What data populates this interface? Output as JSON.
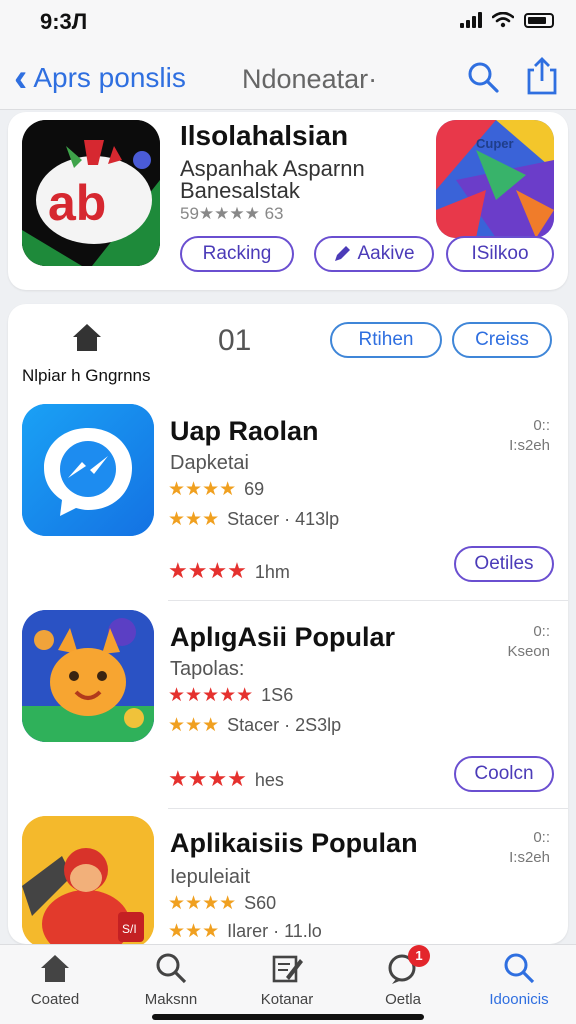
{
  "status": {
    "time": "9:3Л"
  },
  "nav": {
    "back_label": "Aprs ponslis",
    "title": "Ndoneatar·"
  },
  "featured": {
    "title": "Ilsolahalsian",
    "subtitle1": "Aspanhak Asparnn",
    "subtitle2": "Banesalstak",
    "rating": "59★★★★ 63",
    "side_icon_text": "Cuper",
    "buttons": [
      {
        "label": "Racking"
      },
      {
        "label": "Aakive"
      },
      {
        "label": "ISilkoo"
      }
    ]
  },
  "list": {
    "caption": "Nlpiar h Gngrnns",
    "count": "01",
    "header_buttons": [
      {
        "label": "Rtihen"
      },
      {
        "label": "Creiss"
      }
    ],
    "apps": [
      {
        "title": "Uap Raolan",
        "subtitle": "Dapketai",
        "stars1": "★★★★",
        "stars1_meta": "69",
        "stars2": "★★★",
        "stars2_meta": "Stacer · 413lp",
        "stars3": "★★★★",
        "stars3_meta": "1hm",
        "right_line1": "0::",
        "right_line2": "I:s2eh",
        "button": "Oetiles"
      },
      {
        "title": "AplıgAsii Popular",
        "subtitle": "Tapolas:",
        "stars1": "★★★★★",
        "stars1_meta": "1S6",
        "stars2": "★★★",
        "stars2_meta": "Stacer · 2S3lp",
        "stars3": "★★★★",
        "stars3_meta": "hes",
        "right_line1": "0::",
        "right_line2": "Kseon",
        "button": "Coolcn"
      },
      {
        "title": "Aplikaisiis Populan",
        "subtitle": "Iepuleiait",
        "stars1": "★★★★",
        "stars1_meta": "S60",
        "stars2": "★★★",
        "stars2_meta": "Ilarer · 11.lo",
        "right_line1": "0::",
        "right_line2": "I:s2eh"
      }
    ]
  },
  "tabs": [
    {
      "label": "Coated",
      "icon": "home-icon"
    },
    {
      "label": "Maksnn",
      "icon": "search-magnifier-icon"
    },
    {
      "label": "Kotanar",
      "icon": "edit-icon"
    },
    {
      "label": "Oetla",
      "icon": "chat-icon",
      "badge": "1"
    },
    {
      "label": "Idoonicis",
      "icon": "search-icon"
    }
  ],
  "colors": {
    "accent": "#2f6fe0",
    "pill_purple": "#4b3bb8",
    "star_gold": "#f0a020",
    "star_red": "#e5312e"
  }
}
